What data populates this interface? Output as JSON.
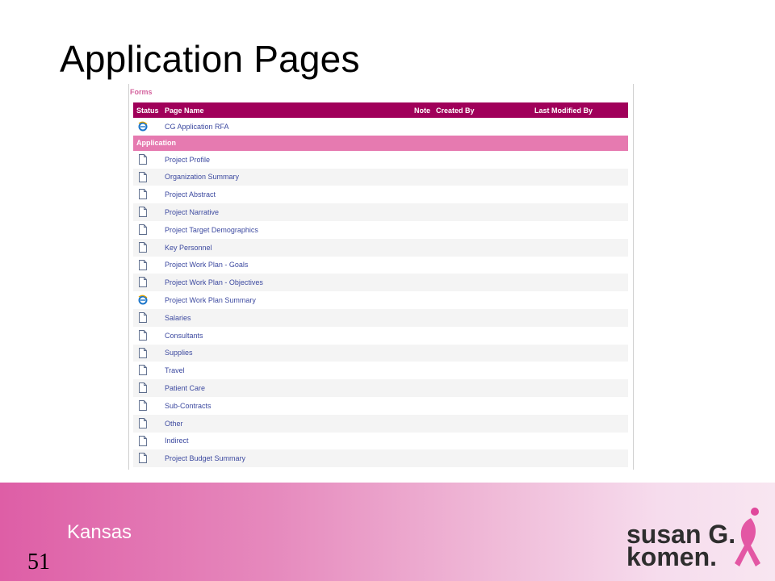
{
  "slide": {
    "title": "Application Pages",
    "region": "Kansas",
    "number": "51",
    "logo_line1": "susan G.",
    "logo_line2": "komen."
  },
  "forms_label": "Forms",
  "table": {
    "headers": {
      "status": "Status",
      "page_name": "Page Name",
      "note": "Note",
      "created_by": "Created By",
      "last_modified_by": "Last Modified By"
    },
    "top_rows": [
      {
        "icon": "ie-icon",
        "name": "CG Application RFA"
      }
    ],
    "section_label": "Application",
    "rows": [
      {
        "icon": "page-icon",
        "name": "Project Profile"
      },
      {
        "icon": "page-icon",
        "name": "Organization Summary"
      },
      {
        "icon": "page-icon",
        "name": "Project Abstract"
      },
      {
        "icon": "page-icon",
        "name": "Project Narrative"
      },
      {
        "icon": "page-icon",
        "name": "Project Target Demographics"
      },
      {
        "icon": "page-icon",
        "name": "Key Personnel"
      },
      {
        "icon": "page-icon",
        "name": "Project Work Plan - Goals"
      },
      {
        "icon": "page-icon",
        "name": "Project Work Plan - Objectives"
      },
      {
        "icon": "ie-icon",
        "name": "Project Work Plan Summary"
      },
      {
        "icon": "page-icon",
        "name": "Salaries"
      },
      {
        "icon": "page-icon",
        "name": "Consultants"
      },
      {
        "icon": "page-icon",
        "name": "Supplies"
      },
      {
        "icon": "page-icon",
        "name": "Travel"
      },
      {
        "icon": "page-icon",
        "name": "Patient Care"
      },
      {
        "icon": "page-icon",
        "name": "Sub-Contracts"
      },
      {
        "icon": "page-icon",
        "name": "Other"
      },
      {
        "icon": "page-icon",
        "name": "Indirect"
      },
      {
        "icon": "page-icon",
        "name": "Project Budget Summary"
      }
    ]
  },
  "colors": {
    "header_bg": "#a0005a",
    "section_bg": "#e67ab0",
    "link": "#3d4aa0",
    "forms_label": "#d4639e"
  }
}
